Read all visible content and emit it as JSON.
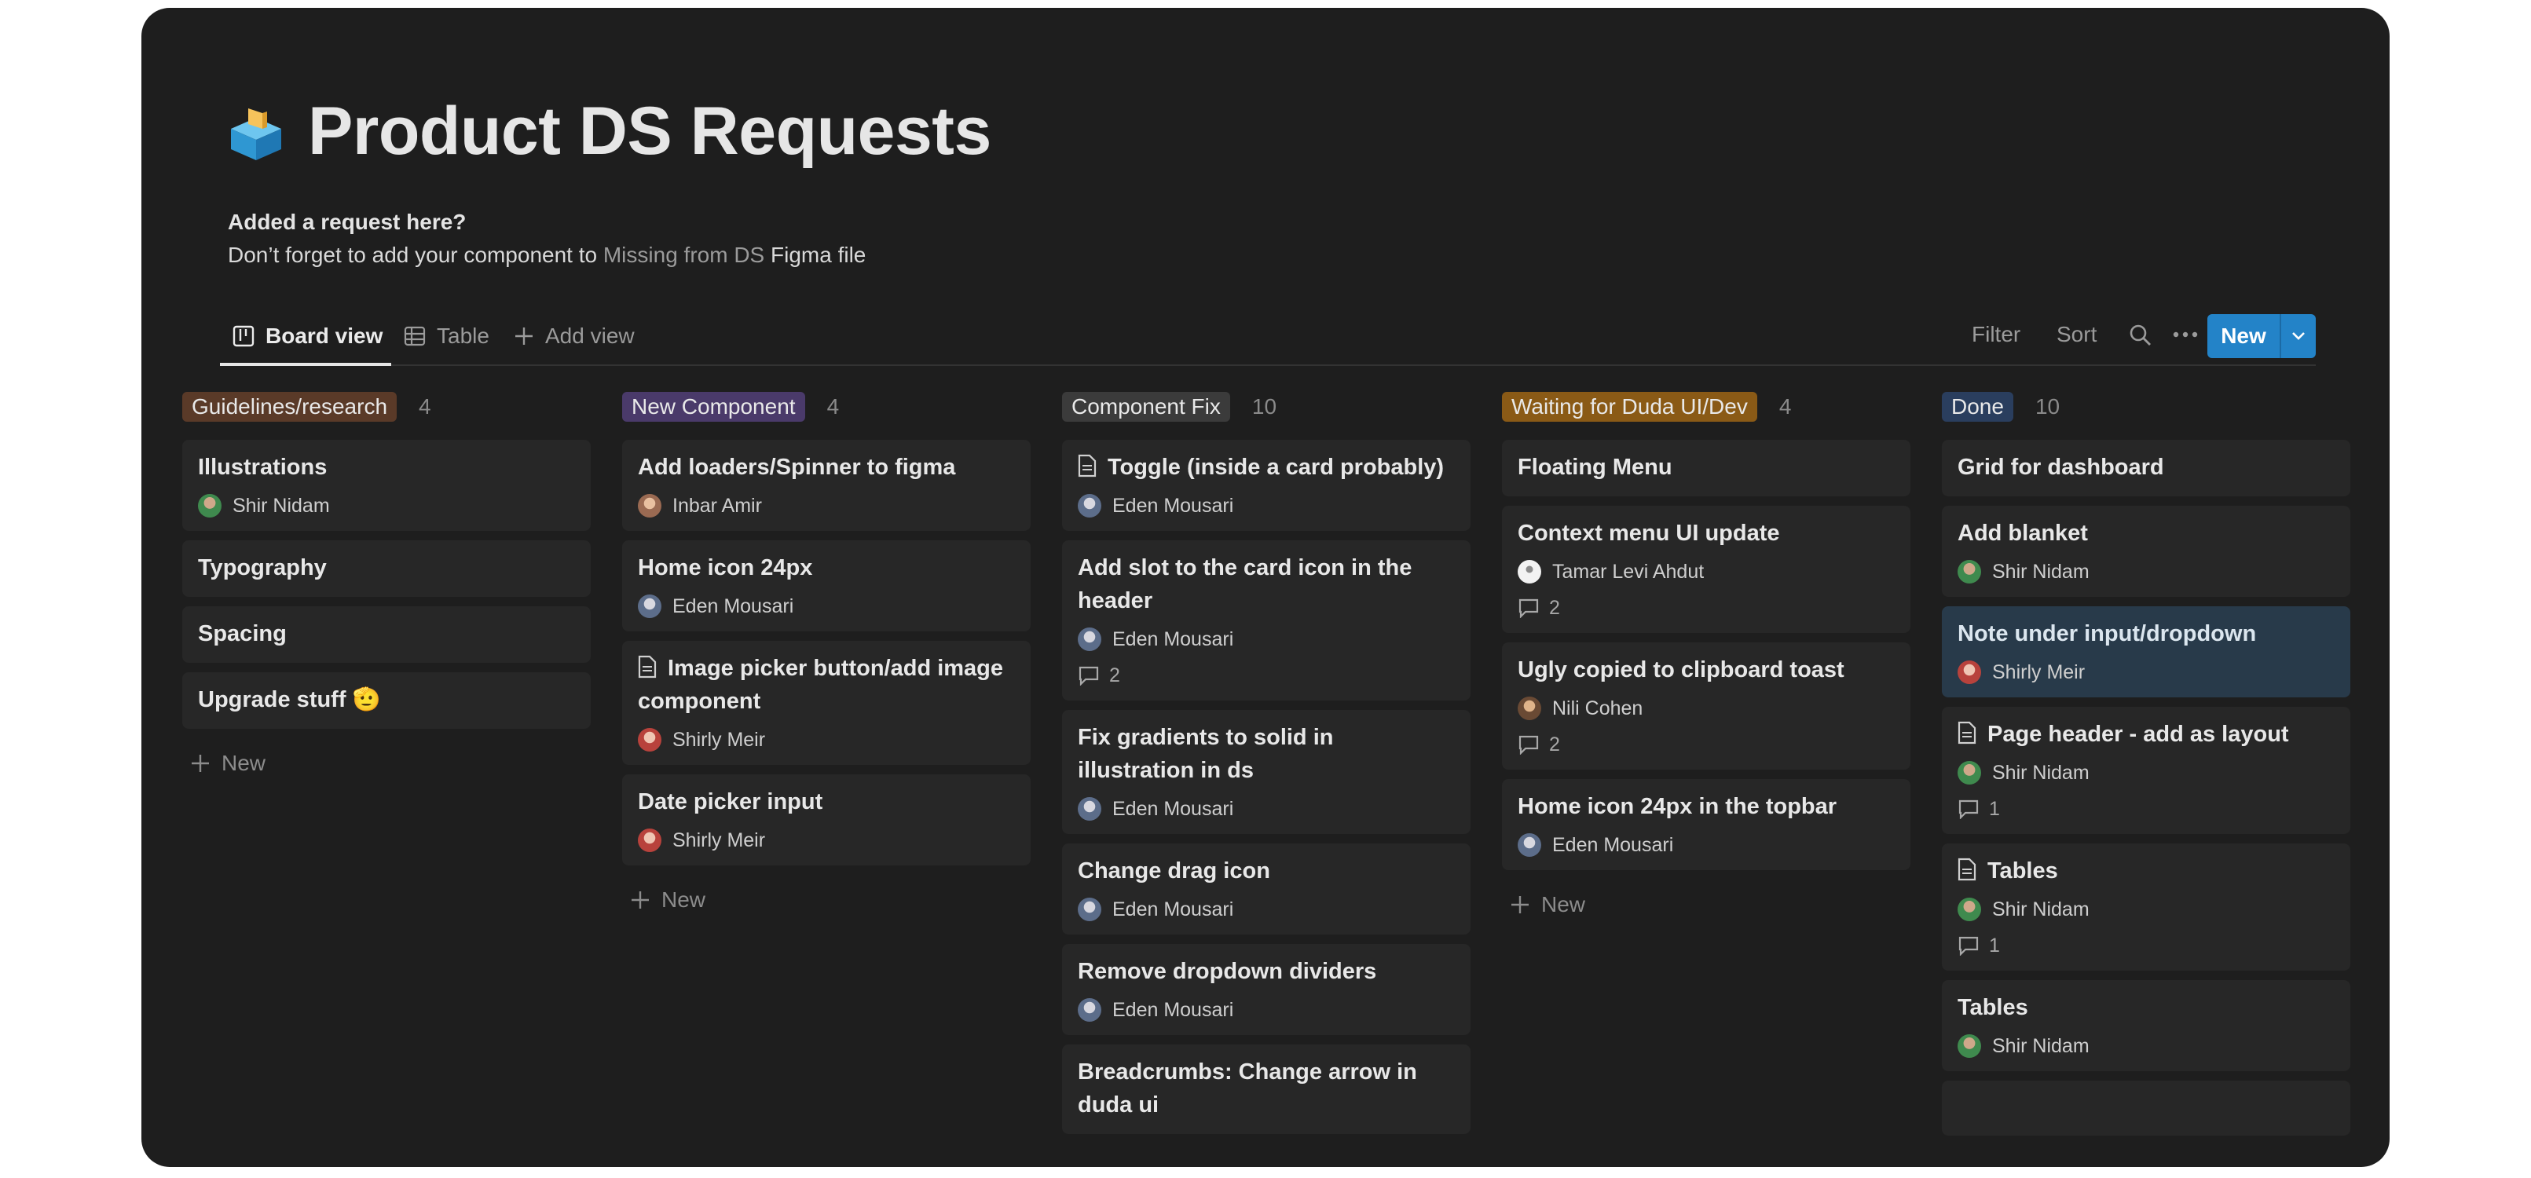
{
  "page": {
    "title": "Product DS Requests",
    "icon": "ballot-box-icon",
    "description": {
      "line1": "Added a request here?",
      "line2_prefix": "Don’t forget to add your component to ",
      "line2_link": "Missing from DS",
      "line2_suffix": " Figma file"
    }
  },
  "views": {
    "tabs": [
      {
        "label": "Board view",
        "icon": "board-icon",
        "active": true
      },
      {
        "label": "Table",
        "icon": "table-icon",
        "active": false
      },
      {
        "label": "Add view",
        "icon": "plus-icon",
        "active": false
      }
    ],
    "filter": "Filter",
    "sort": "Sort",
    "new": "New"
  },
  "colors": {
    "guidelines": "#5a3a28",
    "new_component": "#4a3a6a",
    "component_fix": "#3b3b3b",
    "waiting": "#8a5a16",
    "done": "#2a3e5e",
    "accent": "#2383c8"
  },
  "board": {
    "add_label": "New",
    "columns": [
      {
        "name": "Guidelines/research",
        "count": "4",
        "cards": [
          {
            "title": "Illustrations",
            "person": "Shir Nidam"
          },
          {
            "title": "Typography"
          },
          {
            "title": "Spacing"
          },
          {
            "title": "Upgrade stuff 🫡"
          }
        ]
      },
      {
        "name": "New Component",
        "count": "4",
        "cards": [
          {
            "title": "Add loaders/Spinner to figma",
            "person": "Inbar Amir"
          },
          {
            "title": "Home icon 24px",
            "person": "Eden Mousari"
          },
          {
            "title": "Image picker button/add image component",
            "person": "Shirly Meir",
            "doc": true
          },
          {
            "title": "Date picker input",
            "person": "Shirly Meir"
          }
        ]
      },
      {
        "name": "Component Fix",
        "count": "10",
        "cards": [
          {
            "title": "Toggle (inside a card probably)",
            "person": "Eden Mousari",
            "doc": true
          },
          {
            "title": "Add slot to the card icon in the header",
            "person": "Eden Mousari",
            "comments": "2"
          },
          {
            "title": "Fix gradients to solid in illustration in ds",
            "person": "Eden Mousari"
          },
          {
            "title": "Change drag icon",
            "person": "Eden Mousari"
          },
          {
            "title": "Remove dropdown dividers",
            "person": "Eden Mousari"
          },
          {
            "title": "Breadcrumbs: Change arrow in duda ui"
          }
        ]
      },
      {
        "name": "Waiting for Duda UI/Dev",
        "count": "4",
        "cards": [
          {
            "title": "Floating Menu"
          },
          {
            "title": "Context menu UI update",
            "person": "Tamar Levi Ahdut",
            "comments": "2"
          },
          {
            "title": "Ugly copied to clipboard toast",
            "person": "Nili Cohen",
            "comments": "2"
          },
          {
            "title": "Home icon 24px in the topbar",
            "person": "Eden Mousari"
          }
        ]
      },
      {
        "name": "Done",
        "count": "10",
        "cards": [
          {
            "title": "Grid for dashboard"
          },
          {
            "title": "Add blanket",
            "person": "Shir Nidam"
          },
          {
            "title": "Note under input/dropdown",
            "person": "Shirly Meir",
            "selected": true
          },
          {
            "title": "Page header - add as layout",
            "person": "Shir Nidam",
            "comments": "1",
            "doc": true
          },
          {
            "title": "Tables",
            "person": "Shir Nidam",
            "comments": "1",
            "doc": true
          },
          {
            "title": "Tables",
            "person": "Shir Nidam"
          },
          {
            "title": ""
          }
        ]
      }
    ]
  }
}
